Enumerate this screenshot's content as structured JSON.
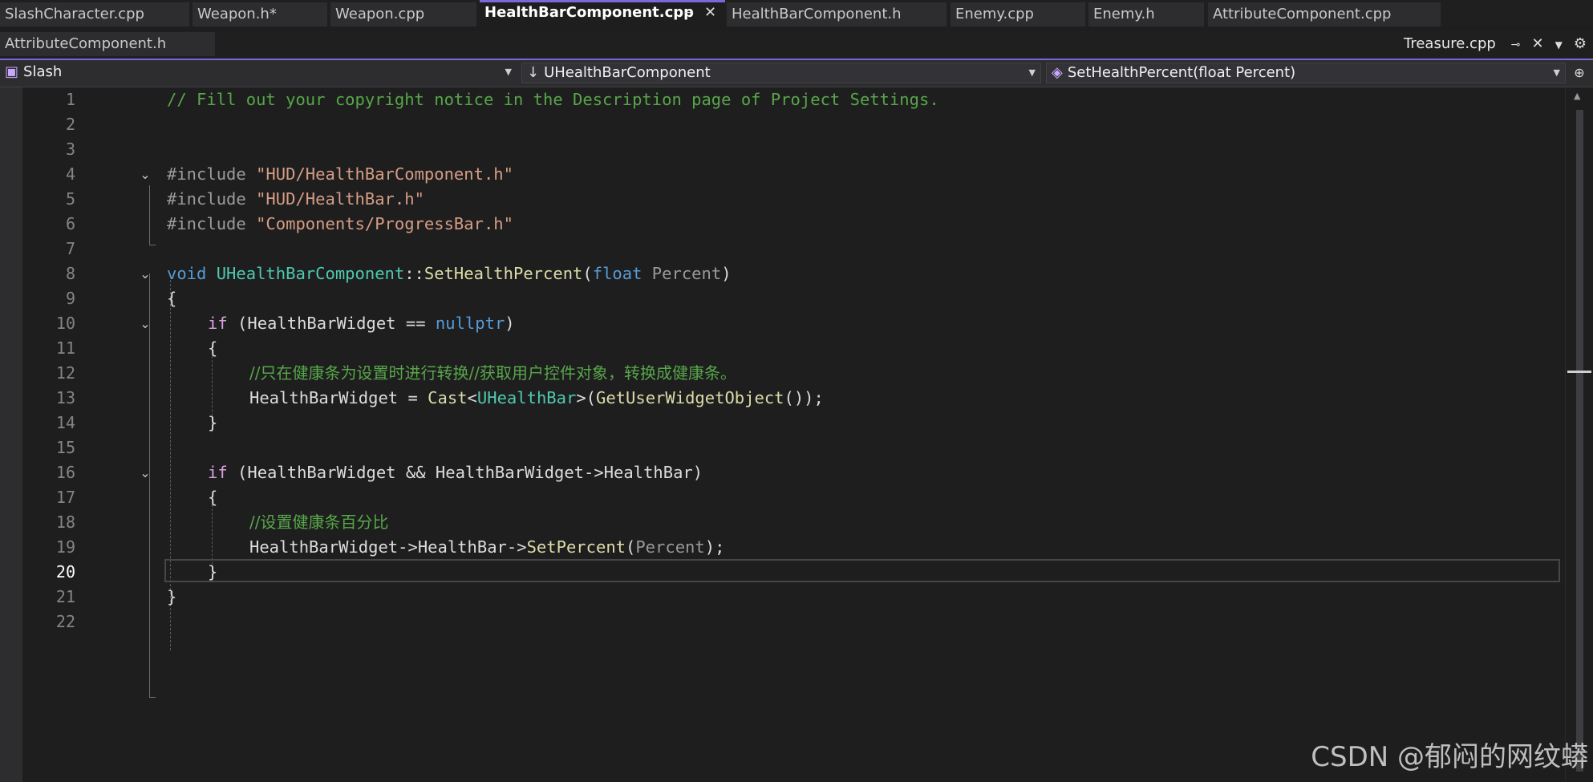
{
  "tabs_row1": [
    {
      "label": "SlashCharacter.cpp",
      "active": false
    },
    {
      "label": "Weapon.h*",
      "active": false
    },
    {
      "label": "Weapon.cpp",
      "active": false
    },
    {
      "label": "HealthBarComponent.cpp",
      "active": true
    },
    {
      "label": "HealthBarComponent.h",
      "active": false
    },
    {
      "label": "Enemy.cpp",
      "active": false
    },
    {
      "label": "Enemy.h",
      "active": false
    },
    {
      "label": "AttributeComponent.cpp",
      "active": false
    }
  ],
  "tabs_row2": [
    {
      "label": "AttributeComponent.h"
    },
    {
      "label": "Treasure.cpp"
    }
  ],
  "navbar": {
    "project": "Slash",
    "scope": "UHealthBarComponent",
    "member": "SetHealthPercent(float Percent)"
  },
  "editor": {
    "current_line": 20,
    "lines": [
      "1",
      "2",
      "3",
      "4",
      "5",
      "6",
      "7",
      "8",
      "9",
      "10",
      "11",
      "12",
      "13",
      "14",
      "15",
      "16",
      "17",
      "18",
      "19",
      "20",
      "21",
      "22"
    ],
    "code": {
      "l1": "// Fill out your copyright notice in the Description page of Project Settings.",
      "inc": "#include",
      "l4s": "\"HUD/HealthBarComponent.h\"",
      "l5s": "\"HUD/HealthBar.h\"",
      "l6s": "\"Components/ProgressBar.h\"",
      "void": "void",
      "cls": "UHealthBarComponent",
      "sep": "::",
      "fn": "SetHealthPercent",
      "float": "float",
      "param": "Percent",
      "ob": "{",
      "cb": "}",
      "if": "if",
      "hbw": "HealthBarWidget",
      "eqnull": " == ",
      "nullptr": "nullptr",
      "l12": "//只在健康条为设置时进行转换//获取用户控件对象，转换成健康条。",
      "l13a": "HealthBarWidget = ",
      "cast": "Cast",
      "uhb": "UHealthBar",
      "gwo": "GetUserWidgetObject",
      "l16mid": " && HealthBarWidget->HealthBar",
      "l18": "//设置健康条百分比",
      "l19a": "HealthBarWidget->HealthBar->",
      "setp": "SetPercent"
    }
  },
  "watermark": "CSDN @郁闷的网纹蟒"
}
